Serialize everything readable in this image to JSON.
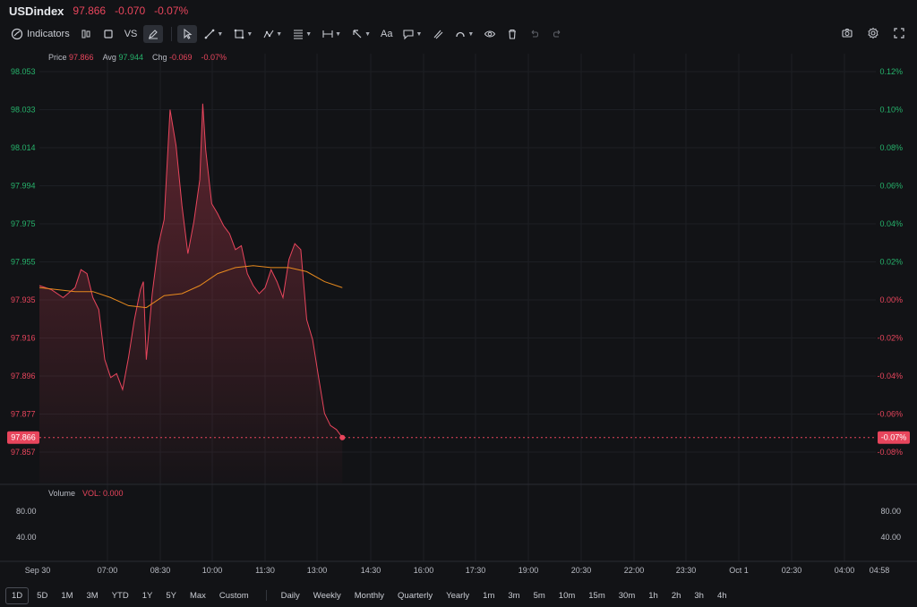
{
  "header": {
    "symbol": "USDindex",
    "last_price": "97.866",
    "change": "-0.070",
    "change_pct": "-0.07%"
  },
  "toolbar": {
    "indicators_label": "Indicators",
    "compare_label": "VS",
    "text_tool_label": "Aa",
    "icons": [
      "indicators-icon",
      "candles-icon",
      "square-icon",
      "pencil-icon",
      "cursor-icon",
      "trendline-icon",
      "shape-icon",
      "pattern-icon",
      "fibonacci-icon",
      "measure-icon",
      "arrow-icon",
      "text-icon",
      "comment-icon",
      "brush-icon",
      "magnet-icon",
      "eye-icon",
      "trash-icon",
      "undo-icon",
      "redo-icon",
      "camera-icon",
      "gear-icon",
      "fullscreen-icon"
    ]
  },
  "legend": {
    "price_label": "Price",
    "price_value": "97.866",
    "avg_label": "Avg",
    "avg_value": "97.944",
    "chg_label": "Chg",
    "chg_value": "-0.069",
    "chg_pct": "-0.07%"
  },
  "volume_legend": {
    "label": "Volume",
    "value": "VOL: 0.000"
  },
  "colors": {
    "down": "#e8455c",
    "up": "#26b26b",
    "avg_line": "#e88a1e",
    "background": "#121316",
    "grid": "#1d1f24"
  },
  "chart_data": {
    "type": "area",
    "y_ticks": [
      "98.053",
      "98.033",
      "98.014",
      "97.994",
      "97.975",
      "97.955",
      "97.935",
      "97.916",
      "97.896",
      "97.877",
      "97.857"
    ],
    "y_ticks_right": [
      "0.12%",
      "0.10%",
      "0.08%",
      "0.06%",
      "0.04%",
      "0.02%",
      "0.00%",
      "-0.02%",
      "-0.04%",
      "-0.06%",
      "-0.08%"
    ],
    "current_price_label": "97.866",
    "current_pct_label": "-0.07%",
    "x_ticks": [
      "Sep 30",
      "07:00",
      "08:30",
      "10:00",
      "11:30",
      "13:00",
      "14:30",
      "16:00",
      "17:30",
      "19:00",
      "20:30",
      "22:00",
      "23:30",
      "Oct 1",
      "02:30",
      "04:00",
      "04:58"
    ],
    "volume_ticks": [
      "80.00",
      "40.00"
    ],
    "price_series": [
      [
        "05:30",
        97.942
      ],
      [
        "05:50",
        97.94
      ],
      [
        "06:10",
        97.936
      ],
      [
        "06:30",
        97.941
      ],
      [
        "06:40",
        97.95
      ],
      [
        "06:50",
        97.948
      ],
      [
        "07:00",
        97.936
      ],
      [
        "07:10",
        97.93
      ],
      [
        "07:20",
        97.905
      ],
      [
        "07:30",
        97.896
      ],
      [
        "07:40",
        97.898
      ],
      [
        "07:50",
        97.89
      ],
      [
        "08:00",
        97.906
      ],
      [
        "08:10",
        97.925
      ],
      [
        "08:20",
        97.94
      ],
      [
        "08:25",
        97.944
      ],
      [
        "08:30",
        97.905
      ],
      [
        "08:40",
        97.938
      ],
      [
        "08:50",
        97.962
      ],
      [
        "09:00",
        97.975
      ],
      [
        "09:10",
        98.03
      ],
      [
        "09:20",
        98.012
      ],
      [
        "09:30",
        97.982
      ],
      [
        "09:40",
        97.958
      ],
      [
        "09:50",
        97.974
      ],
      [
        "10:00",
        97.995
      ],
      [
        "10:05",
        98.033
      ],
      [
        "10:10",
        98.01
      ],
      [
        "10:20",
        97.983
      ],
      [
        "10:30",
        97.978
      ],
      [
        "10:40",
        97.972
      ],
      [
        "10:50",
        97.968
      ],
      [
        "11:00",
        97.96
      ],
      [
        "11:10",
        97.962
      ],
      [
        "11:20",
        97.948
      ],
      [
        "11:30",
        97.942
      ],
      [
        "11:40",
        97.938
      ],
      [
        "11:50",
        97.941
      ],
      [
        "12:00",
        97.95
      ],
      [
        "12:10",
        97.944
      ],
      [
        "12:20",
        97.936
      ],
      [
        "12:30",
        97.955
      ],
      [
        "12:40",
        97.963
      ],
      [
        "12:50",
        97.96
      ],
      [
        "13:00",
        97.925
      ],
      [
        "13:10",
        97.915
      ],
      [
        "13:20",
        97.896
      ],
      [
        "13:30",
        97.878
      ],
      [
        "13:40",
        97.872
      ],
      [
        "13:50",
        97.87
      ],
      [
        "14:00",
        97.866
      ]
    ],
    "avg_series": [
      [
        "05:30",
        97.941
      ],
      [
        "06:30",
        97.939
      ],
      [
        "07:00",
        97.939
      ],
      [
        "07:30",
        97.936
      ],
      [
        "08:00",
        97.932
      ],
      [
        "08:30",
        97.931
      ],
      [
        "09:00",
        97.937
      ],
      [
        "09:30",
        97.938
      ],
      [
        "10:00",
        97.942
      ],
      [
        "10:30",
        97.948
      ],
      [
        "11:00",
        97.951
      ],
      [
        "11:30",
        97.952
      ],
      [
        "12:00",
        97.951
      ],
      [
        "12:30",
        97.951
      ],
      [
        "13:00",
        97.949
      ],
      [
        "13:30",
        97.944
      ],
      [
        "14:00",
        97.941
      ]
    ],
    "ylim": [
      97.852,
      98.058
    ],
    "grid": true
  },
  "bottom": {
    "periods": [
      "1D",
      "5D",
      "1M",
      "3M",
      "YTD",
      "1Y",
      "5Y",
      "Max",
      "Custom"
    ],
    "active_period": "1D",
    "intervals": [
      "Daily",
      "Weekly",
      "Monthly",
      "Quarterly",
      "Yearly",
      "1m",
      "3m",
      "5m",
      "10m",
      "15m",
      "30m",
      "1h",
      "2h",
      "3h",
      "4h"
    ]
  }
}
